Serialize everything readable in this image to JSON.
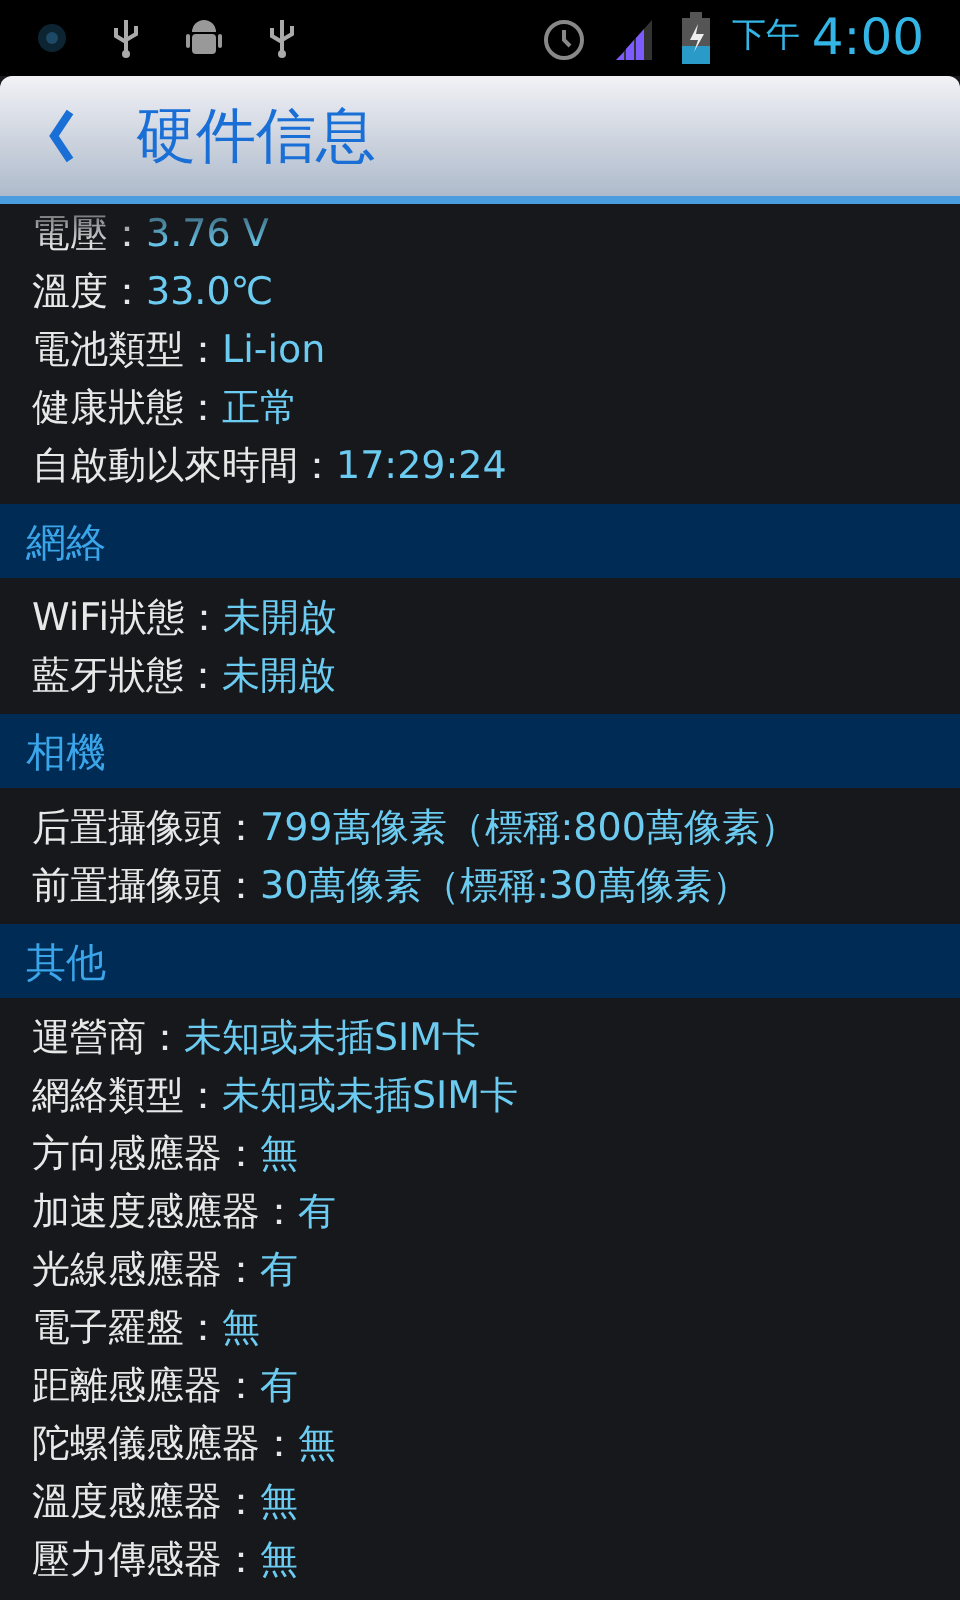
{
  "status_bar": {
    "ampm": "下午",
    "time": "4:00"
  },
  "header": {
    "title": "硬件信息"
  },
  "sections": [
    {
      "rows": [
        {
          "label": "電壓：",
          "value": "3.76 V"
        },
        {
          "label": "溫度：",
          "value": "33.0℃"
        },
        {
          "label": "電池類型：",
          "value": "Li-ion"
        },
        {
          "label": "健康狀態：",
          "value": "正常"
        },
        {
          "label": "自啟動以來時間：",
          "value": "17:29:24"
        }
      ]
    },
    {
      "title": "網絡",
      "rows": [
        {
          "label": "WiFi狀態：",
          "value": "未開啟"
        },
        {
          "label": "藍牙狀態：",
          "value": "未開啟"
        }
      ]
    },
    {
      "title": "相機",
      "rows": [
        {
          "label": "后置攝像頭：",
          "value": "799萬像素（標稱:800萬像素）"
        },
        {
          "label": "前置攝像頭：",
          "value": "30萬像素（標稱:30萬像素）"
        }
      ]
    },
    {
      "title": "其他",
      "rows": [
        {
          "label": "運營商：",
          "value": "未知或未插SIM卡"
        },
        {
          "label": "網絡類型：",
          "value": "未知或未插SIM卡"
        },
        {
          "label": "方向感應器：",
          "value": "無"
        },
        {
          "label": "加速度感應器：",
          "value": "有"
        },
        {
          "label": "光線感應器：",
          "value": "有"
        },
        {
          "label": "電子羅盤：",
          "value": "無"
        },
        {
          "label": "距離感應器：",
          "value": "有"
        },
        {
          "label": "陀螺儀感應器：",
          "value": "無"
        },
        {
          "label": "溫度感應器：",
          "value": "無"
        },
        {
          "label": "壓力傳感器：",
          "value": "無"
        }
      ]
    }
  ]
}
